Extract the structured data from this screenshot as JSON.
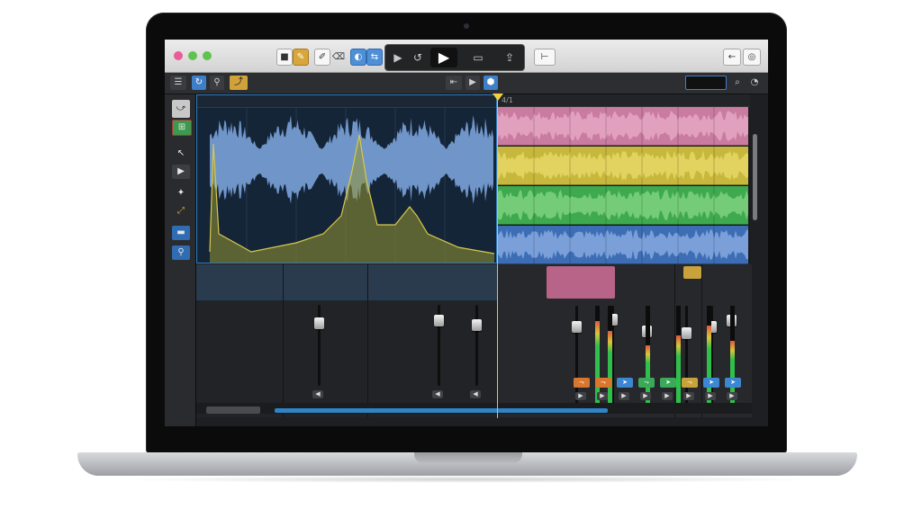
{
  "toolbar": {
    "buttons": [
      {
        "name": "stop-mode-button",
        "glyph": "■"
      },
      {
        "name": "pencil-tool-button",
        "glyph": "✎"
      },
      {
        "name": "edit-button",
        "glyph": "✐"
      },
      {
        "name": "eraser-button",
        "glyph": "⌫"
      },
      {
        "name": "loop-button",
        "glyph": "◐"
      },
      {
        "name": "link-button",
        "glyph": "⇆"
      }
    ],
    "transport": [
      {
        "name": "rewind-button",
        "glyph": "▶"
      },
      {
        "name": "cycle-button",
        "glyph": "↺"
      },
      {
        "name": "play-button",
        "glyph": "▶"
      },
      {
        "name": "record-button",
        "glyph": "▭"
      },
      {
        "name": "export-button",
        "glyph": "⇪"
      }
    ],
    "tuner_glyph": "⊢",
    "back_glyph": "←",
    "help_glyph": "◎"
  },
  "control_bar": {
    "menu_glyph": "☰",
    "buttons": [
      "↻",
      "⚲",
      "⤴"
    ],
    "right": [
      "⇤",
      "▶",
      "⬢"
    ],
    "search_placeholder": "",
    "search_glyph": "⌕"
  },
  "tools": [
    "⤻",
    "⊞",
    "↖",
    "▶",
    "✦",
    "⤢",
    "▬",
    "⚲"
  ],
  "ruler": {
    "marks": [
      "4/1",
      "",
      "",
      "",
      "",
      "",
      ""
    ]
  },
  "tracks": [
    {
      "color": "#c97ba0",
      "wave": "#e6a7c4"
    },
    {
      "color": "#c7b73c",
      "wave": "#e6d765"
    },
    {
      "color": "#3ea94f",
      "wave": "#7ed27f"
    },
    {
      "color": "#3d6eb5",
      "wave": "#86a9df"
    }
  ],
  "mixer": {
    "left_faders": [
      0.16,
      0.12,
      0.18
    ],
    "right_faders": [
      0.15,
      0.08,
      0.2,
      0.22,
      0.15,
      0.09,
      0.2
    ],
    "meters": [
      0.85,
      0.75,
      0.6,
      0.7,
      0.65,
      0.8
    ],
    "chips": [
      {
        "color": "orange",
        "glyph": "⤳"
      },
      {
        "color": "orange",
        "glyph": "⤳"
      },
      {
        "color": "blue",
        "glyph": "➤"
      },
      {
        "color": "green",
        "glyph": "⤳"
      },
      {
        "color": "green",
        "glyph": "➤"
      },
      {
        "color": "gold",
        "glyph": "⤳"
      },
      {
        "color": "blue",
        "glyph": "➤"
      },
      {
        "color": "blue",
        "glyph": "➤"
      }
    ]
  },
  "colors": {
    "accent_blue": "#2f84c7",
    "playhead": "#e8c53a",
    "editor_wave": "#6f95c9",
    "spectrum": "#9a9a3a"
  }
}
